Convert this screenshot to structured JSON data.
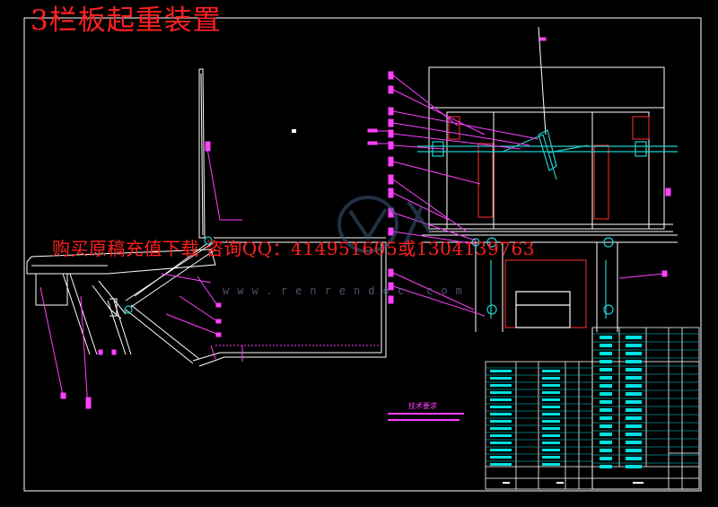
{
  "drawing": {
    "title": "3栏板起重装置",
    "promo_text": "购买原稿充值下载 咨询QQ：414951605或1304139763",
    "watermark": "www.renrendoc.com",
    "notes_title": "技术要求"
  },
  "colors": {
    "background": "#000000",
    "outline": "#ffffff",
    "callout": "#ff40ff",
    "part": "#20d0d0",
    "title": "#ff2020",
    "table": "#00e0e0"
  }
}
